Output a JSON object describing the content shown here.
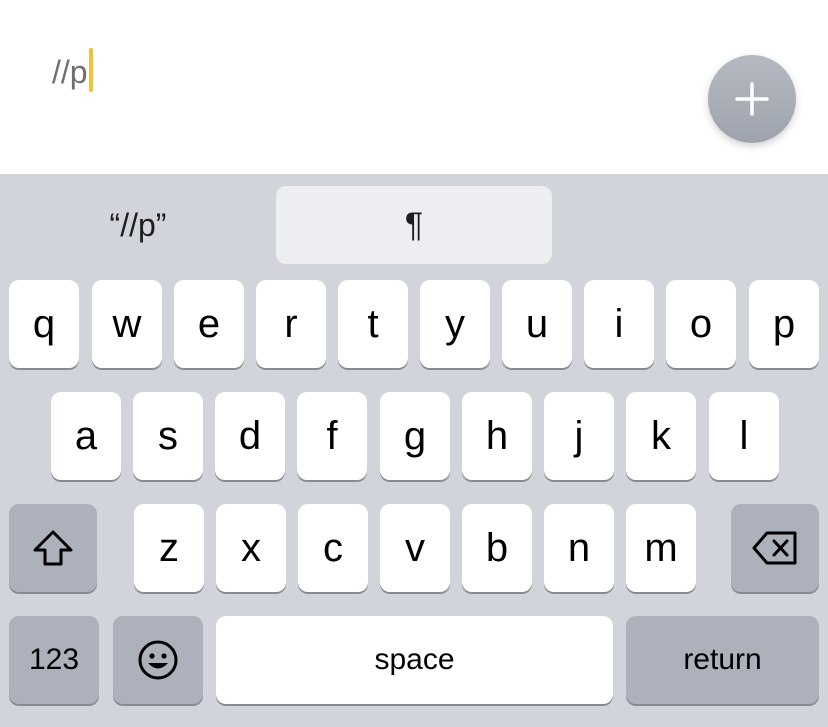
{
  "editor": {
    "text": "//p"
  },
  "fab": {
    "icon": "plus-icon"
  },
  "suggestions": [
    {
      "label": "“//p”"
    },
    {
      "label": "¶"
    },
    {
      "label": ""
    }
  ],
  "keyboard": {
    "row1": [
      "q",
      "w",
      "e",
      "r",
      "t",
      "y",
      "u",
      "i",
      "o",
      "p"
    ],
    "row2": [
      "a",
      "s",
      "d",
      "f",
      "g",
      "h",
      "j",
      "k",
      "l"
    ],
    "row3": [
      "z",
      "x",
      "c",
      "v",
      "b",
      "n",
      "m"
    ],
    "numbers_label": "123",
    "space_label": "space",
    "return_label": "return",
    "shift_icon": "shift-icon",
    "delete_icon": "delete-icon",
    "emoji_icon": "emoji-icon"
  },
  "colors": {
    "caret": "#f0c23b",
    "keyboard_bg": "#d1d4db",
    "special_key_bg": "#acb1bb",
    "fab_bg": "#a9aeb6"
  }
}
